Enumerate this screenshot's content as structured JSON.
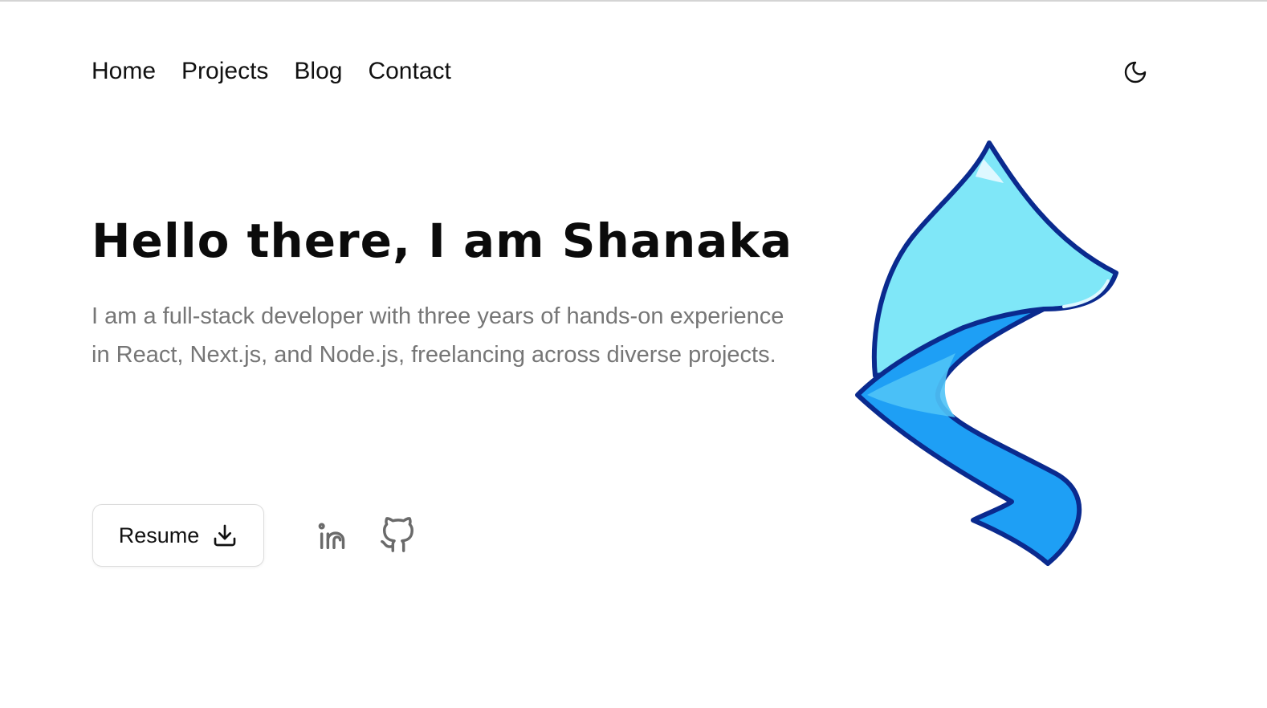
{
  "nav": {
    "items": [
      {
        "label": "Home"
      },
      {
        "label": "Projects"
      },
      {
        "label": "Blog"
      },
      {
        "label": "Contact"
      }
    ],
    "theme_toggle_icon": "moon-icon"
  },
  "hero": {
    "title": "Hello there, I am Shanaka",
    "description": "I am a full-stack developer with three years of hands-on experience in React, Next.js, and Node.js, freelancing across diverse projects."
  },
  "actions": {
    "resume_label": "Resume",
    "resume_icon": "download-icon",
    "socials": [
      {
        "icon": "linkedin-icon"
      },
      {
        "icon": "github-icon"
      }
    ]
  },
  "colors": {
    "text": "#111111",
    "muted": "#767676",
    "logo_light": "#7fe7f8",
    "logo_mid": "#4fc3f7",
    "logo_deep": "#1e9ff5",
    "logo_outline": "#0a2a8e"
  }
}
